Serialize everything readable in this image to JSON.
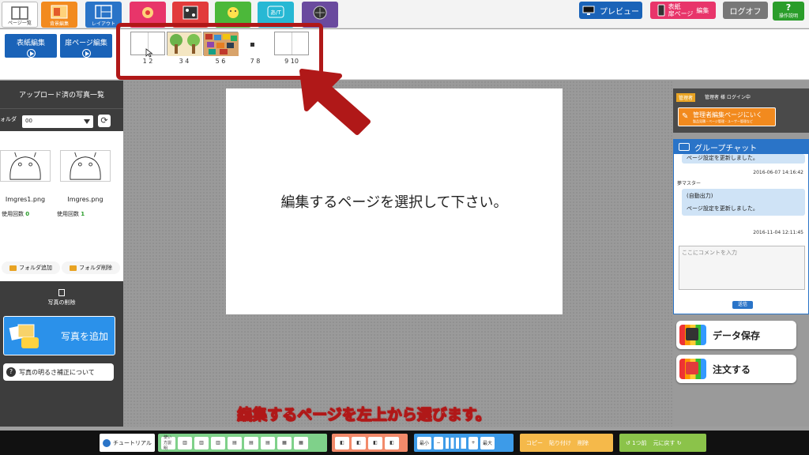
{
  "top_tabs": [
    {
      "label": "ページ一覧",
      "color": "#ffffff",
      "active": true
    },
    {
      "label": "背景編集",
      "color": "#f28a1e",
      "active": false
    },
    {
      "label": "レイアウト",
      "color": "#2a74c8",
      "active": false
    },
    {
      "label": "",
      "color": "#e8356a",
      "active": false
    },
    {
      "label": "",
      "color": "#e23b3b",
      "active": false
    },
    {
      "label": "",
      "color": "#4cb83a",
      "active": false
    },
    {
      "label": "",
      "color": "#27b8d4",
      "active": false
    },
    {
      "label": "",
      "color": "#6a4a9e",
      "active": false
    }
  ],
  "tab_glyph_text": "あ/T",
  "header": {
    "preview_label": "プレビュー",
    "cover_label_1": "表紙",
    "cover_label_2": "扉ページ",
    "cover_edit": "編集",
    "logoff_label": "ログオフ",
    "help_mark": "?",
    "help_label": "操作説明"
  },
  "subbar": {
    "cover_edit_label": "表紙編集",
    "door_edit_label": "扉ページ編集",
    "thumbnails": [
      {
        "label": "1 2"
      },
      {
        "label": "3 4"
      },
      {
        "label": "5 6"
      },
      {
        "label": "7 8"
      },
      {
        "label": "9 10"
      }
    ]
  },
  "left_panel": {
    "title": "アップロード済の写真一覧",
    "folder_label": "ォルダ",
    "folder_value": "00",
    "photos": [
      {
        "name": "Imgres1.png",
        "use_label": "使用回数",
        "use_count": "0"
      },
      {
        "name": "Imgres.png",
        "use_label": "使用回数",
        "use_count": "1"
      }
    ],
    "add_folder": "フォルダ追加",
    "delete_folder": "フォルダ削除",
    "delete_photo": "写真の削除",
    "add_photo": "写真を追加",
    "brightness": "写真の明るさ補正について"
  },
  "canvas": {
    "message": "編集するページを選択して下さい。"
  },
  "right_panel": {
    "admin_tag": "管理者",
    "admin_status": "管理者 様 ログイン中",
    "admin_button": "管理者編集ページにいく",
    "admin_button_sub": "製品見積・ページ管理・ユーザー管理など",
    "chat_title": "グループチャット",
    "chat_messages": [
      {
        "text": "ページ設定を更新しました。",
        "time": "2016-06-07 14:16:42"
      },
      {
        "user": "夢マスター",
        "prefix": "(自動出力)",
        "text": "ページ設定を更新しました。",
        "time": "2016-11-04 12:11:45"
      }
    ],
    "chat_placeholder": "ここにコメントを入力",
    "send_label": "送信",
    "save_label": "データ保存",
    "order_label": "注文する"
  },
  "subtitle": "編集するページを左上から選びます。",
  "bottom_bar": {
    "tutorial": "チュートリアル",
    "usage": "使い方説明",
    "zoom_min": "最小",
    "zoom_max": "最大",
    "copy": "コピー",
    "paste": "貼り付け",
    "delete": "削除",
    "undo": "1つ前",
    "redo": "元に戻す"
  },
  "colors": {
    "accent_blue": "#1a63b8",
    "highlight_red": "#b01818",
    "chat_blue": "#2a74c8",
    "orange": "#f28a1e"
  }
}
